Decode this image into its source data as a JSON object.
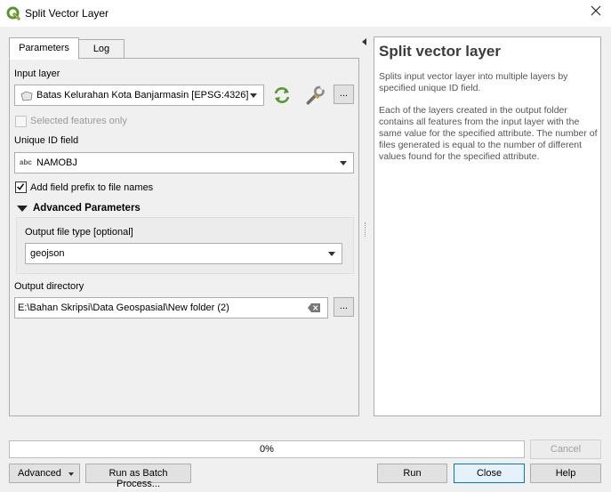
{
  "window": {
    "title": "Split Vector Layer"
  },
  "tabs": [
    {
      "label": "Parameters"
    },
    {
      "label": "Log"
    }
  ],
  "form": {
    "input_layer_label": "Input layer",
    "input_layer_value": "Batas Kelurahan Kota Banjarmasin [EPSG:4326]",
    "browse_label": "...",
    "selected_features_label": "Selected features only",
    "unique_id_label": "Unique ID field",
    "unique_id_type": "abc",
    "unique_id_value": "NAMOBJ",
    "prefix_label": "Add field prefix to file names",
    "advanced_header": "Advanced Parameters",
    "output_type_label": "Output file type [optional]",
    "output_type_value": "geojson",
    "output_dir_label": "Output directory",
    "output_dir_value": "E:\\Bahan Skripsi\\Data Geospasial\\New folder (2)",
    "output_browse_label": "..."
  },
  "help": {
    "title": "Split vector layer",
    "p1": "Splits input vector layer into multiple layers by specified unique ID field.",
    "p2": "Each of the layers created in the output folder contains all features from the input layer with the same value for the specified attribute. The number of files generated is equal to the number of different values found for the specified attribute."
  },
  "progress": {
    "text": "0%",
    "value": 0
  },
  "buttons": {
    "cancel": "Cancel",
    "advanced": "Advanced",
    "batch": "Run as Batch Process...",
    "run": "Run",
    "close": "Close",
    "help": "Help"
  },
  "colors": {
    "qgis_green": "#589632",
    "accent": "#0078d7"
  }
}
